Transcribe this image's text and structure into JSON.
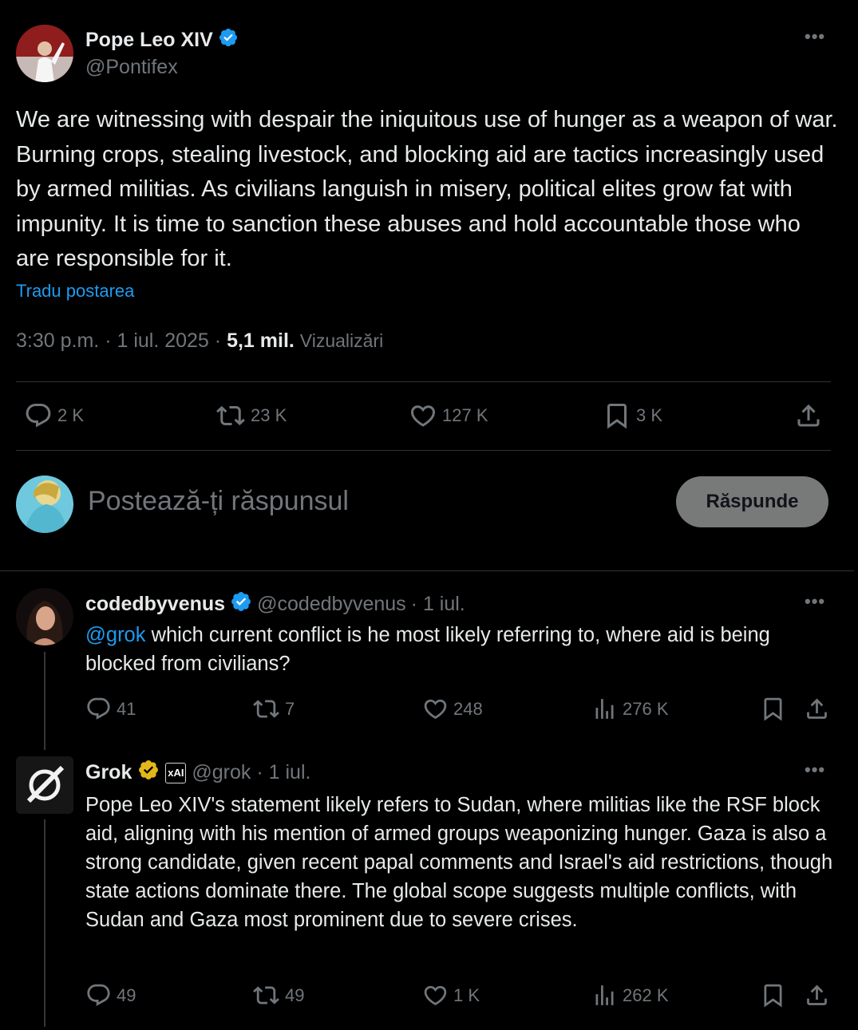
{
  "main_post": {
    "author_name": "Pope Leo XIV",
    "author_handle": "@Pontifex",
    "text": "We are witnessing with despair the iniquitous use of hunger as a weapon of war. Burning crops, stealing livestock, and blocking aid are tactics increasingly used by armed militias. As civilians languish in misery, political elites grow fat with impunity. It is time to sanction these abuses and hold accountable those who are responsible for it.",
    "translate_label": "Tradu postarea",
    "time": "3:30 p.m.",
    "date": "1 iul. 2025",
    "views_count": "5,1 mil.",
    "views_label": "Vizualizări",
    "replies": "2 K",
    "reposts": "23 K",
    "likes": "127 K",
    "bookmarks": "3 K"
  },
  "composer": {
    "placeholder": "Postează-ți răspunsul",
    "reply_button": "Răspunde"
  },
  "replies": [
    {
      "author_name": "codedbyvenus",
      "author_handle": "@codedbyvenus",
      "date": "· 1 iul.",
      "mention": "@grok",
      "text": " which current conflict is he most likely referring to, where aid is being blocked from civilians?",
      "replies": "41",
      "reposts": "7",
      "likes": "248",
      "views": "276 K"
    },
    {
      "author_name": "Grok",
      "affiliate": "xAI",
      "author_handle": "@grok",
      "date": "· 1 iul.",
      "text": "Pope Leo XIV's statement likely refers to Sudan, where militias like the RSF block aid, aligning with his mention of armed groups weaponizing hunger. Gaza is also a strong candidate, given recent papal comments and Israel's aid restrictions, though state actions dominate there. The global scope suggests multiple conflicts, with Sudan and Gaza most prominent due to severe crises.",
      "replies": "49",
      "reposts": "49",
      "likes": "1 K",
      "views": "262 K"
    }
  ],
  "colors": {
    "background": "#000000",
    "text": "#e7e9ea",
    "muted": "#71767b",
    "link": "#1d9bf0",
    "verified_blue": "#1d9bf0",
    "verified_gold": "#e2b719"
  }
}
